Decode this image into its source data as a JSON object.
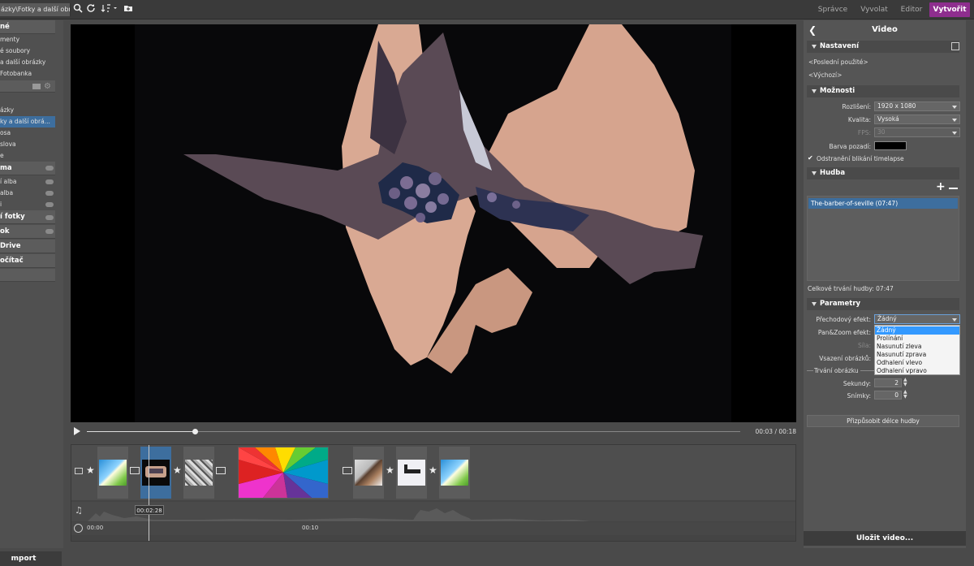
{
  "topbar": {
    "path": "ázky\\Fotky a další obrázky",
    "modes": [
      "Správce",
      "Vyvolat",
      "Editor",
      "Vytvořit"
    ],
    "active_mode": "Vytvořit"
  },
  "left": {
    "items_top": [
      "né",
      "menty",
      "é soubory",
      "a další obrázky",
      "Fotobanka"
    ],
    "items_mid": [
      "ázky",
      "ky a další obrá...",
      "osa",
      "slova",
      "e"
    ],
    "hdr_sit": "ma",
    "items_cloud": [
      "í alba",
      "alba",
      "i"
    ],
    "hdr_fotky": "í fotky",
    "hdr_ok": "ok",
    "hdr_drive": "Drive",
    "hdr_pc": "očítač",
    "import": "mport"
  },
  "player": {
    "time": "00:03 / 00:18",
    "progress": 0.167
  },
  "timeline": {
    "cursor_time": "00:02:28",
    "ruler": [
      "00:00",
      "00:10"
    ]
  },
  "right": {
    "title": "Video",
    "sec_settings": "Nastavení",
    "last_used": "<Poslední použité>",
    "default": "<Výchozí>",
    "sec_options": "Možnosti",
    "res_label": "Rozlišení:",
    "res_value": "1920 x 1080",
    "quality_label": "Kvalita:",
    "quality_value": "Vysoká",
    "fps_label": "FPS:",
    "fps_value": "30",
    "bg_label": "Barva pozadí:",
    "bg_color": "#000000",
    "flicker_label": "Odstranění blikání timelapse",
    "sec_music": "Hudba",
    "music_item": "The-barber-of-seville (07:47)",
    "music_total": "Celkové trvání hudby: 07:47",
    "sec_params": "Parametry",
    "transition_label": "Přechodový efekt:",
    "transition_value": "Žádný",
    "panzoom_label": "Pan&Zoom efekt:",
    "strength_label": "Síla:",
    "insert_label": "Vsazení obrázků:",
    "duration_label": "Trvání obrázku",
    "seconds_label": "Sekundy:",
    "seconds_value": "2",
    "frames_label": "Snímky:",
    "frames_value": "0",
    "fit_button": "Přizpůsobit délce hudby",
    "save_button": "Uložit video...",
    "dropdown_options": [
      "Žádný",
      "Prolínání",
      "Nasunutí zleva",
      "Nasunutí zprava",
      "Odhalení vlevo",
      "Odhalení vpravo"
    ]
  }
}
